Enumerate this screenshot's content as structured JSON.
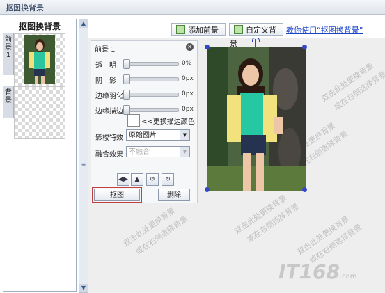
{
  "window": {
    "title": "抠图换背景"
  },
  "left_panel": {
    "title": "抠图换背景",
    "tabs": [
      {
        "label": "前景 1"
      },
      {
        "label": "背景"
      }
    ]
  },
  "toolbar": {
    "add_foreground_label": "添加前景",
    "custom_background_label": "自定义背景",
    "help_link": "教你使用“抠图换背景”"
  },
  "properties": {
    "title": "前景 1",
    "rows": [
      {
        "label": "透　明",
        "value": "0%"
      },
      {
        "label": "阴　影",
        "value": "0px"
      },
      {
        "label": "边缘羽化",
        "value": "0px"
      },
      {
        "label": "边缘描边",
        "value": "0px"
      }
    ],
    "stroke_color_label": "<<更换描边颜色",
    "effect_label": "影楼特效",
    "effect_value": "原始图片",
    "blend_label": "融合效果",
    "blend_value": "不融合",
    "cutout_button": "抠图",
    "delete_button": "删除"
  },
  "watermark": {
    "lines": [
      "双击此处更换背景",
      "或在右侧选择背景"
    ],
    "logo": "IT168",
    "logo_suffix": ".com"
  },
  "colors": {
    "accent_red": "#c24040",
    "link_blue": "#1a44c8",
    "selection_blue": "#3348a8"
  }
}
